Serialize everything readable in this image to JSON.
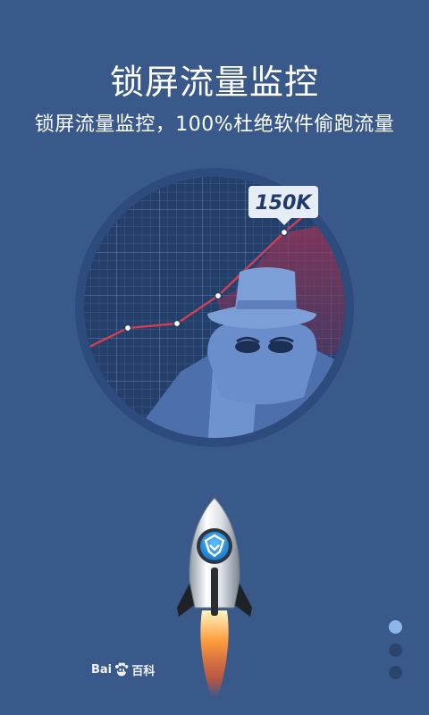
{
  "header": {
    "title": "锁屏流量监控",
    "subtitle": "锁屏流量监控，100%杜绝软件偷跑流量"
  },
  "illustration": {
    "callout": "150K",
    "line_color": "#d53d55",
    "grid_bg": "#243f6b"
  },
  "brand": {
    "part1": "Bai",
    "part2": "du",
    "part3": "百科"
  },
  "pager": {
    "pages": 3,
    "active_index": 0
  }
}
